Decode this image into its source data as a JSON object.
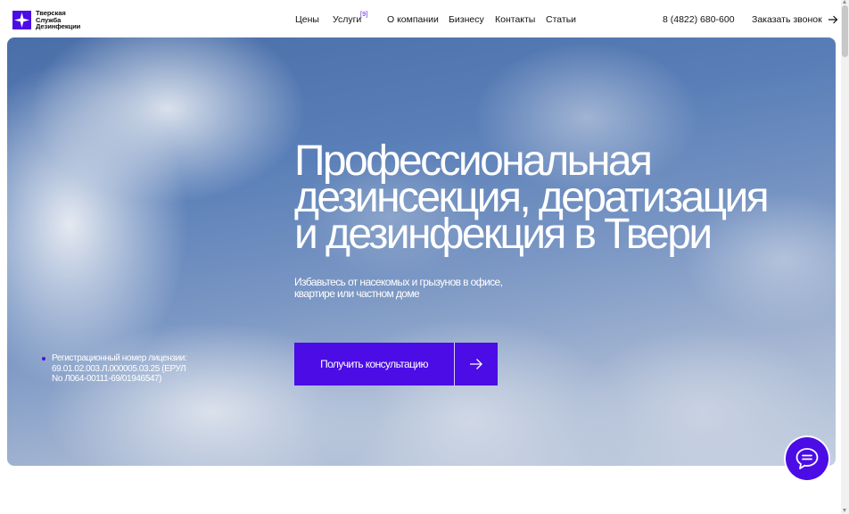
{
  "brand": {
    "name_lines": [
      "Тверская",
      "Служба",
      "Дезинфекции"
    ],
    "accent_color": "#4b0ce6"
  },
  "nav": {
    "items": [
      {
        "label": "Цены"
      },
      {
        "label": "Услуги",
        "badge": "9"
      },
      {
        "label": "О компании"
      },
      {
        "label": "Бизнесу"
      },
      {
        "label": "Контакты"
      },
      {
        "label": "Статьи"
      }
    ]
  },
  "header": {
    "phone": "8 (4822) 680-600",
    "callback_label": "Заказать звонок",
    "callback_icon": "arrow-right-icon"
  },
  "hero": {
    "title_lines": [
      "Профессиональная",
      "дезинсекция, дератизация",
      "и дезинфекция в Твери"
    ],
    "subtitle_lines": [
      "Избавьтесь от насекомых и грызунов в офисе,",
      "квартире или частном доме"
    ],
    "cta_label": "Получить консультацию",
    "cta_icon": "arrow-right-icon",
    "background": "clouds-sky-photo"
  },
  "license": {
    "lines": [
      "Регистрационный номер лицензии:",
      "69.01.02.003.Л.000005.03.25 (ЕРУЛ",
      "No Л064-00111-69/01946547)"
    ]
  },
  "chat": {
    "icon": "chat-bubble-icon"
  }
}
